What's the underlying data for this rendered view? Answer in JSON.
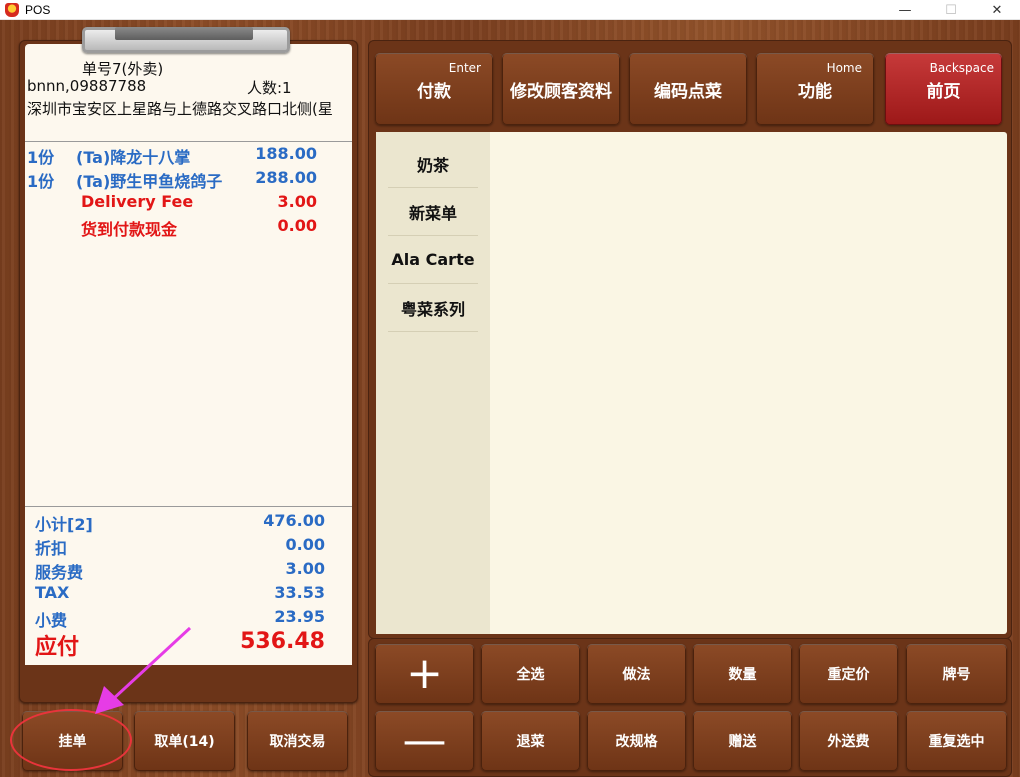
{
  "window": {
    "title": "POS",
    "minimize": "—",
    "maximize": "☐",
    "close": "✕"
  },
  "receipt": {
    "order_no": "单号7(外卖)",
    "customer": "bnnn,09887788",
    "people": "人数:1",
    "address": "深圳市宝安区上星路与上德路交叉路口北侧(星",
    "items": [
      {
        "qty": "1份",
        "name": "(Ta)降龙十八掌",
        "price": "188.00",
        "highlight": false
      },
      {
        "qty": "1份",
        "name": "(Ta)野生甲鱼烧鸽子",
        "price": "288.00",
        "highlight": false
      },
      {
        "qty": "",
        "name": "Delivery Fee",
        "price": "3.00",
        "highlight": true
      },
      {
        "qty": "",
        "name": "货到付款现金",
        "price": "0.00",
        "highlight": true
      }
    ],
    "totals": [
      {
        "label": "小计[2]",
        "value": "476.00"
      },
      {
        "label": "折扣",
        "value": "0.00"
      },
      {
        "label": "服务费",
        "value": "3.00"
      },
      {
        "label": "TAX",
        "value": "33.53"
      },
      {
        "label": "小费",
        "value": "23.95"
      }
    ],
    "amount_due": {
      "label": "应付",
      "value": "536.48"
    }
  },
  "left_buttons": {
    "hold": "挂单",
    "retrieve": "取单(14)",
    "cancel": "取消交易"
  },
  "top_buttons": {
    "pay": {
      "label": "付款",
      "key": "Enter"
    },
    "edit_customer": {
      "label": "修改顾客资料"
    },
    "code_order": {
      "label": "编码点菜"
    },
    "functions": {
      "label": "功能",
      "key": "Home"
    },
    "home": {
      "label": "前页",
      "key": "Backspace"
    }
  },
  "categories": [
    "奶茶",
    "新菜单",
    "Ala Carte",
    "粤菜系列"
  ],
  "action_buttons_row1": {
    "plus": "+",
    "select_all": "全选",
    "method": "做法",
    "quantity": "数量",
    "reprice": "重定价",
    "plate_no": "牌号"
  },
  "action_buttons_row2": {
    "minus": "—",
    "return": "退菜",
    "change_spec": "改规格",
    "gift": "赠送",
    "delivery_fee": "外送费",
    "repeat_selected": "重复选中"
  },
  "colors": {
    "wood": "#7a3f1f",
    "item_blue": "#2a6bc4",
    "item_red": "#e21616",
    "receipt_bg": "#fdf8ee",
    "home_button": "#b02424",
    "annotation": "#e8343b",
    "arrow": "#e63ce6"
  }
}
